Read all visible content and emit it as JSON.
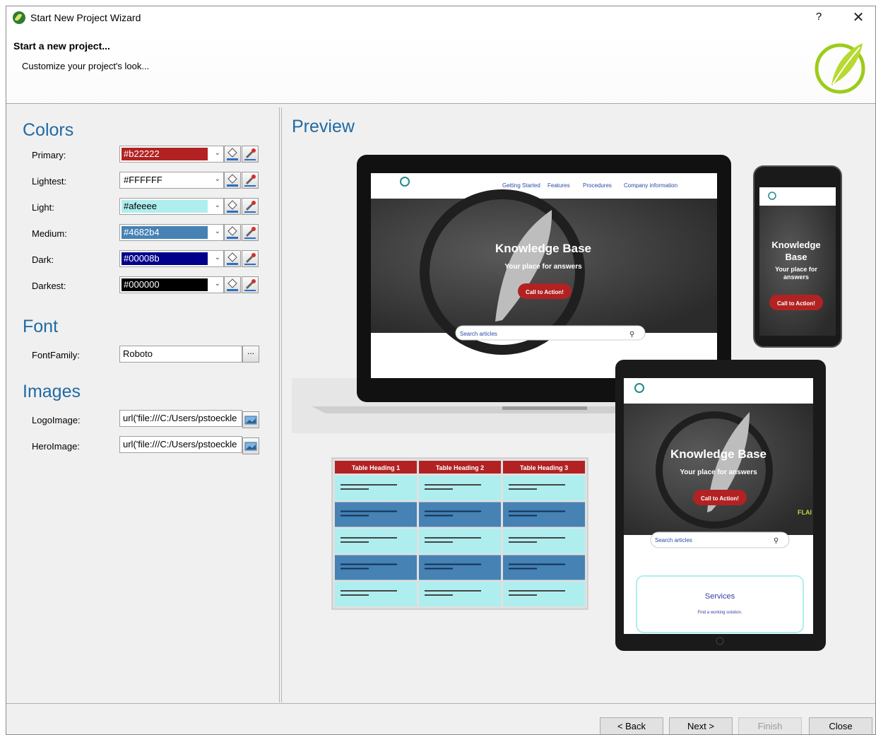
{
  "window": {
    "title": "Start New Project Wizard",
    "help": "?",
    "close": "✕"
  },
  "header": {
    "title": "Start a new project...",
    "subtitle": "Customize your project's look..."
  },
  "colors": {
    "section": "Colors",
    "items": [
      {
        "label": "Primary:",
        "value": "#b22222",
        "swatch": "#b22222",
        "text_color": "#ffffff"
      },
      {
        "label": "Lightest:",
        "value": "#FFFFFF",
        "swatch": "#ffffff",
        "text_color": "#000000"
      },
      {
        "label": "Light:",
        "value": "#afeeee",
        "swatch": "#afeeee",
        "text_color": "#000000"
      },
      {
        "label": "Medium:",
        "value": "#4682b4",
        "swatch": "#4682b4",
        "text_color": "#ffffff"
      },
      {
        "label": "Dark:",
        "value": "#00008b",
        "swatch": "#00008b",
        "text_color": "#ffffff"
      },
      {
        "label": "Darkest:",
        "value": "#000000",
        "swatch": "#000000",
        "text_color": "#ffffff"
      }
    ]
  },
  "font": {
    "section": "Font",
    "label": "FontFamily:",
    "value": "Roboto",
    "browse": "..."
  },
  "images": {
    "section": "Images",
    "logo_label": "LogoImage:",
    "logo_value": "url('file:///C:/Users/pstoeckle",
    "hero_label": "HeroImage:",
    "hero_value": "url('file:///C:/Users/pstoeckle"
  },
  "preview": {
    "title": "Preview",
    "nav": [
      "Getting Started",
      "Features",
      "Procedures",
      "Company information"
    ],
    "hero_title": "Knowledge Base",
    "hero_sub": "Your place for answers",
    "phone_title_1": "Knowledge",
    "phone_title_2": "Base",
    "phone_sub_1": "Your place for",
    "phone_sub_2": "answers",
    "cta": "Call to Action!",
    "search": "Search articles",
    "flag": "FLAI",
    "services_title": "Services",
    "services_sub": "Find a working solution.",
    "table_headings": [
      "Table Heading 1",
      "Table Heading 2",
      "Table Heading 3"
    ]
  },
  "footer": {
    "back": "< Back",
    "next": "Next >",
    "finish": "Finish",
    "close": "Close"
  }
}
